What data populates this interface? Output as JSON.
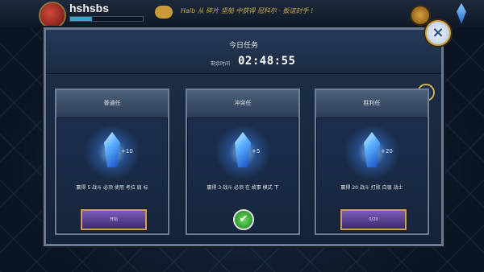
{
  "hud": {
    "player_name": "hshsbs",
    "xp_fraction": 0.3,
    "ticker_text": "Halb 从 碎片 坚船 中获得 冠科尔 · 扳谊封手 !"
  },
  "modal": {
    "title": "今日任务",
    "timer_label": "剩余时间",
    "timer": "02:48:55"
  },
  "quests": [
    {
      "title": "普通任",
      "reward": "+10",
      "description": "赢得 5 战斗 必须 使用 考拉 肩 标",
      "button_label": "开始",
      "state": "available"
    },
    {
      "title": "冲突任",
      "reward": "+5",
      "description": "赢得 3 战斗 必须 在 故事 模式 下",
      "button_label": "",
      "state": "completed"
    },
    {
      "title": "胜利任",
      "reward": "+20",
      "description": "赢得 20 战斗 打败 白银 战士",
      "button_label": "0/20",
      "state": "in-progress"
    }
  ],
  "icons": {
    "close_main": "×",
    "close_small": "×",
    "check": "✔"
  },
  "colors": {
    "accent_gold": "#c8a040",
    "button_purple": "#6a4caa",
    "crystal_blue": "#5ab0ff",
    "check_green": "#3cb83c"
  }
}
